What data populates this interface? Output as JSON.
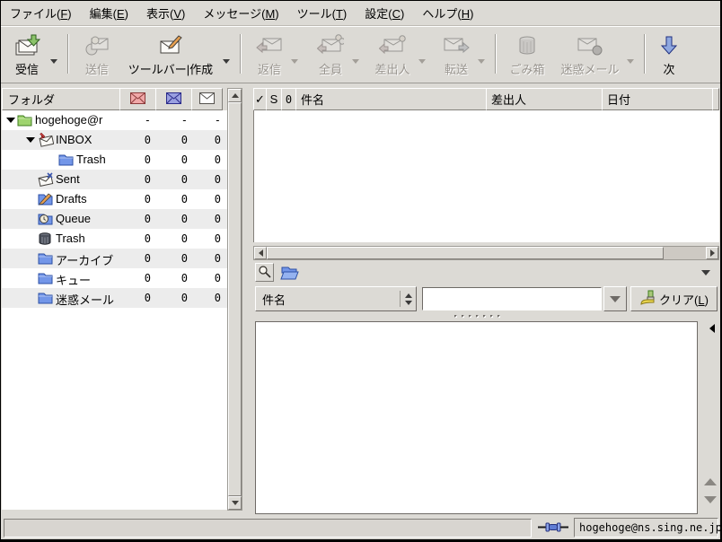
{
  "menu_bar": {
    "items": [
      "ファイル(F)",
      "編集(E)",
      "表示(V)",
      "メッセージ(M)",
      "ツール(T)",
      "設定(C)",
      "ヘルプ(H)"
    ]
  },
  "toolbar": {
    "receive_label": "受信",
    "send_label": "送信",
    "compose_label": "ツールバー|作成",
    "reply_label": "返信",
    "reply_all_label": "全員",
    "reply_sender_label": "差出人",
    "forward_label": "転送",
    "trash_label": "ごみ箱",
    "junk_label": "迷惑メール",
    "next_label": "次"
  },
  "folder_pane": {
    "header_title": "フォルダ",
    "rows": [
      {
        "name": "hogehoge@r",
        "new": "-",
        "unread": "-",
        "total": "-"
      },
      {
        "name": "INBOX",
        "new": "0",
        "unread": "0",
        "total": "0"
      },
      {
        "name": "Trash",
        "new": "0",
        "unread": "0",
        "total": "0"
      },
      {
        "name": "Sent",
        "new": "0",
        "unread": "0",
        "total": "0"
      },
      {
        "name": "Drafts",
        "new": "0",
        "unread": "0",
        "total": "0"
      },
      {
        "name": "Queue",
        "new": "0",
        "unread": "0",
        "total": "0"
      },
      {
        "name": "Trash",
        "new": "0",
        "unread": "0",
        "total": "0"
      },
      {
        "name": "アーカイブ",
        "new": "0",
        "unread": "0",
        "total": "0"
      },
      {
        "name": "キュー",
        "new": "0",
        "unread": "0",
        "total": "0"
      },
      {
        "name": "迷惑メール",
        "new": "0",
        "unread": "0",
        "total": "0"
      }
    ]
  },
  "message_list": {
    "columns": {
      "check": "✓",
      "status": "S",
      "clip": "0",
      "subject": "件名",
      "from": "差出人",
      "date": "日付"
    }
  },
  "quick_search": {
    "field_selector": "件名",
    "entry_value": "",
    "clear_label": "クリア(L)"
  },
  "status_bar": {
    "account": "hogehoge@ns.sing.ne.jp"
  },
  "colors": {
    "window_bg": "#dcdad5",
    "new_envelope_red": "#f0a8a8",
    "unread_envelope_blue": "#9aa0e0",
    "folder_blue": "#7396e8",
    "account_folder_green": "#9fd46f",
    "next_arrow_blue": "#8fa8e0",
    "disabled_text": "#98948e"
  }
}
